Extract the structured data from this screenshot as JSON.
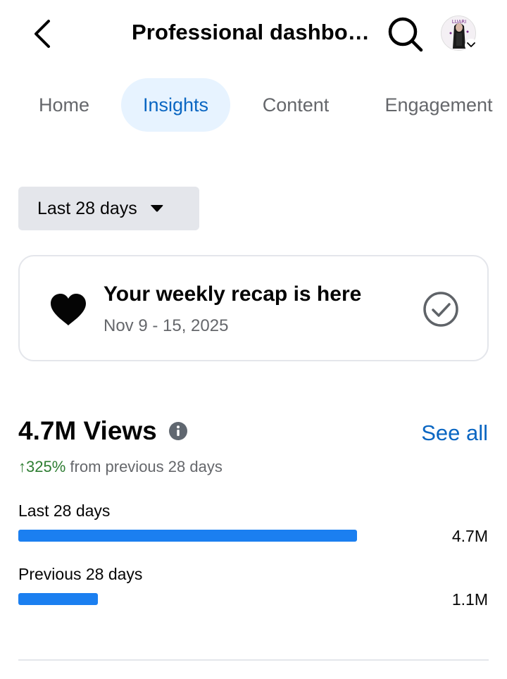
{
  "header": {
    "title": "Professional dashbo…",
    "avatar_text": "LUARI"
  },
  "tabs": [
    {
      "label": "Home",
      "active": false
    },
    {
      "label": "Insights",
      "active": true
    },
    {
      "label": "Content",
      "active": false
    },
    {
      "label": "Engagement",
      "active": false
    }
  ],
  "date_range": {
    "selected": "Last 28 days"
  },
  "recap": {
    "title": "Your weekly recap is here",
    "dates": "Nov 9 - 15, 2025"
  },
  "views": {
    "title": "4.7M Views",
    "see_all": "See all",
    "change_pct": "↑325%",
    "change_text": " from previous 28 days",
    "bars": [
      {
        "label": "Last 28 days",
        "value": "4.7M",
        "fraction": 1.0
      },
      {
        "label": "Previous 28 days",
        "value": "1.1M",
        "fraction": 0.234
      }
    ]
  },
  "colors": {
    "accent": "#0a66c2",
    "bar": "#1b7ff0",
    "positive": "#2e7d32",
    "active_tab_bg": "#e7f3ff"
  }
}
